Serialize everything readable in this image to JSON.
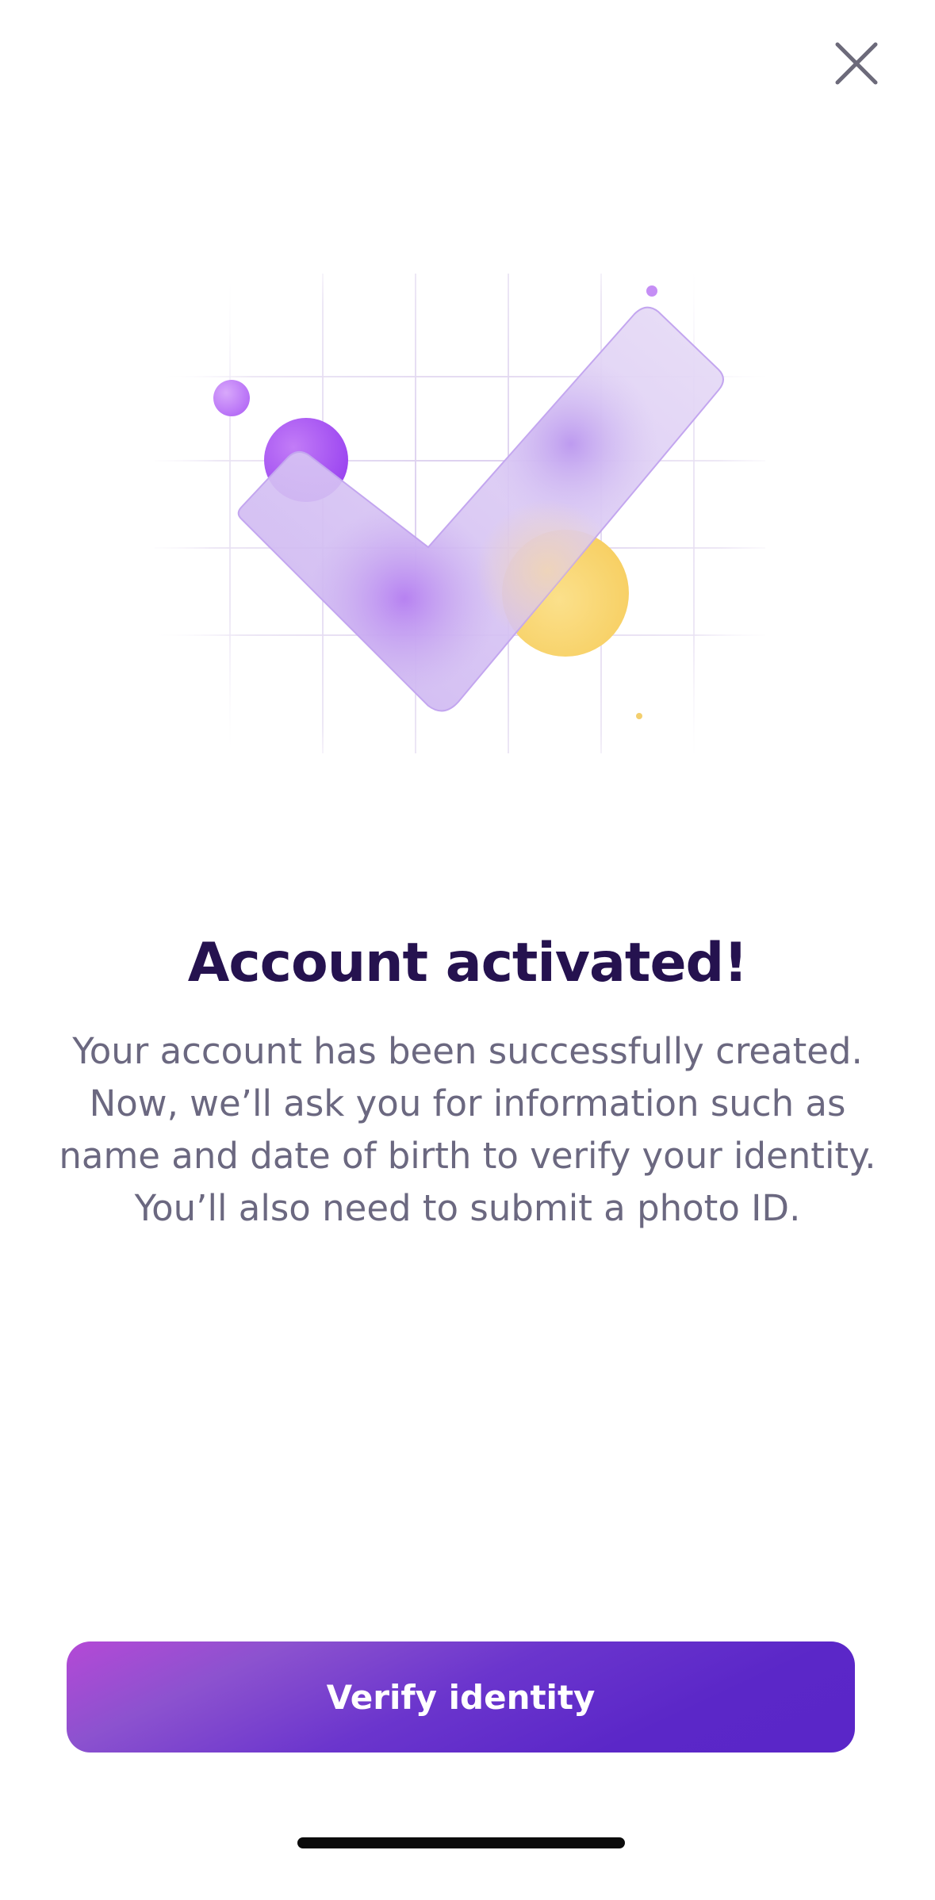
{
  "header": {
    "close_icon": "close-icon"
  },
  "illustration": {
    "icon": "check-icon",
    "colors": {
      "purple": "#a855f7",
      "lavender": "#d8c7f3",
      "yellow": "#f9d77a",
      "grid": "#e6def2"
    }
  },
  "main": {
    "title": "Account activated!",
    "body_lines": [
      "Your account has been successfully created.",
      "Now, we’ll ask you for information such as",
      "name and date of birth to verify your identity.",
      "You’ll also need to submit a photo ID."
    ]
  },
  "footer": {
    "cta_label": "Verify identity",
    "cta_colors": [
      "#b449d6",
      "#5a26c8"
    ]
  }
}
